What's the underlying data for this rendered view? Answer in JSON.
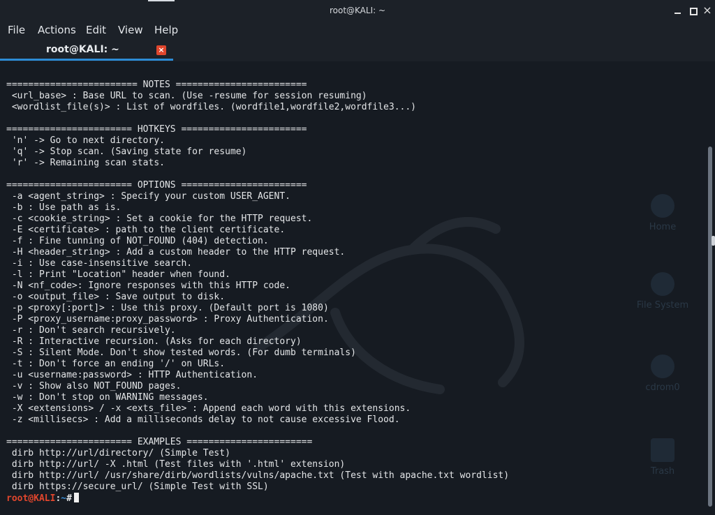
{
  "window": {
    "title": "root@KALI: ~",
    "controls": {
      "minimize_icon": "minimize-icon",
      "maximize_icon": "maximize-icon",
      "close_icon": "close-icon",
      "close_glyph": "×"
    }
  },
  "menubar": {
    "items": [
      "File",
      "Actions",
      "Edit",
      "View",
      "Help"
    ]
  },
  "tabs": [
    {
      "label": "root@KALI: ~",
      "close_glyph": "×",
      "active": true
    }
  ],
  "desktop_icons": [
    "Home",
    "File System",
    "cdrom0",
    "Trash"
  ],
  "terminal": {
    "lines": [
      "======================== NOTES ========================",
      " <url_base> : Base URL to scan. (Use -resume for session resuming)",
      " <wordlist_file(s)> : List of wordfiles. (wordfile1,wordfile2,wordfile3...)",
      "",
      "======================= HOTKEYS =======================",
      " 'n' -> Go to next directory.",
      " 'q' -> Stop scan. (Saving state for resume)",
      " 'r' -> Remaining scan stats.",
      "",
      "======================= OPTIONS =======================",
      " -a <agent_string> : Specify your custom USER_AGENT.",
      " -b : Use path as is.",
      " -c <cookie_string> : Set a cookie for the HTTP request.",
      " -E <certificate> : path to the client certificate.",
      " -f : Fine tunning of NOT_FOUND (404) detection.",
      " -H <header_string> : Add a custom header to the HTTP request.",
      " -i : Use case-insensitive search.",
      " -l : Print \"Location\" header when found.",
      " -N <nf_code>: Ignore responses with this HTTP code.",
      " -o <output_file> : Save output to disk.",
      " -p <proxy[:port]> : Use this proxy. (Default port is 1080)",
      " -P <proxy_username:proxy_password> : Proxy Authentication.",
      " -r : Don't search recursively.",
      " -R : Interactive recursion. (Asks for each directory)",
      " -S : Silent Mode. Don't show tested words. (For dumb terminals)",
      " -t : Don't force an ending '/' on URLs.",
      " -u <username:password> : HTTP Authentication.",
      " -v : Show also NOT_FOUND pages.",
      " -w : Don't stop on WARNING messages.",
      " -X <extensions> / -x <exts_file> : Append each word with this extensions.",
      " -z <millisecs> : Add a milliseconds delay to not cause excessive Flood.",
      "",
      "======================= EXAMPLES =======================",
      " dirb http://url/directory/ (Simple Test)",
      " dirb http://url/ -X .html (Test files with '.html' extension)",
      " dirb http://url/ /usr/share/dirb/wordlists/vulns/apache.txt (Test with apache.txt wordlist)",
      " dirb https://secure_url/ (Simple Test with SSL)"
    ],
    "prompt": {
      "user": "root@KALI",
      "sep": ":",
      "path": "~",
      "symbol": "#"
    }
  },
  "colors": {
    "background": "#161b22",
    "prompt_user": "#e0462d",
    "prompt_path": "#3b8fd8",
    "tab_accent": "#2d8cd6",
    "text": "#e4e6e8"
  }
}
